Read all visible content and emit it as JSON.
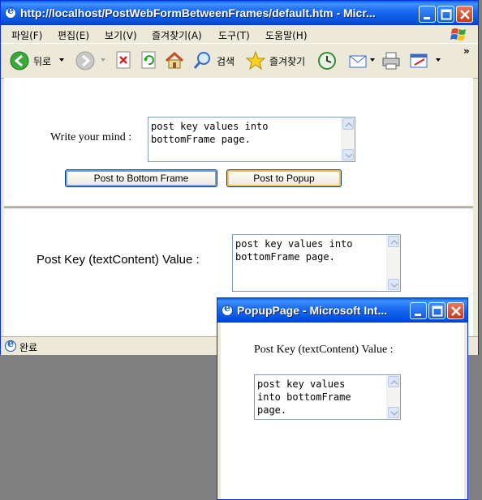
{
  "main_window": {
    "title": "http://localhost/PostWebFormBetweenFrames/default.htm - Micr...",
    "menu": [
      "파일(F)",
      "편집(E)",
      "보기(V)",
      "즐겨찾기(A)",
      "도구(T)",
      "도움말(H)"
    ],
    "toolbar": {
      "back": "뒤로",
      "search": "검색",
      "favorites": "즐겨찾기"
    },
    "status": "완료"
  },
  "top_frame": {
    "label": "Write your mind :",
    "textarea_value": "post key values into\nbottomFrame page.",
    "buttons": {
      "post_bottom": "Post to Bottom Frame",
      "post_popup": "Post to Popup"
    }
  },
  "bottom_frame": {
    "label": "Post Key (textContent) Value :",
    "textarea_value": "post key values into\nbottomFrame page."
  },
  "popup": {
    "title": "PopupPage - Microsoft Int...",
    "label": "Post Key (textContent) Value :",
    "textarea_value": "post key values\ninto bottomFrame\npage."
  },
  "colors": {
    "titlebar": "#0a5ee0",
    "chrome": "#ece9d8",
    "desktop": "#808080"
  }
}
